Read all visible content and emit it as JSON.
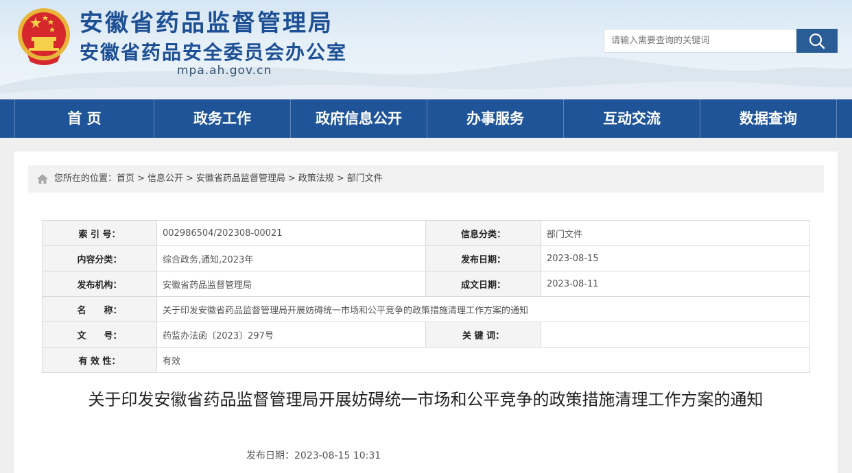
{
  "header": {
    "org_name": "安徽省药品监督管理局",
    "org_sub": "安徽省药品安全委员会办公室",
    "domain": "mpa.ah.gov.cn",
    "search_placeholder": "请输入需要查询的关键词",
    "emblem_icon": "national-emblem-icon",
    "search_icon": "search-icon"
  },
  "nav": {
    "items": [
      {
        "label": "首 页"
      },
      {
        "label": "政务工作"
      },
      {
        "label": "政府信息公开"
      },
      {
        "label": "办事服务"
      },
      {
        "label": "互动交流"
      },
      {
        "label": "数据查询"
      }
    ]
  },
  "breadcrumb": {
    "prefix": "您所在的位置：",
    "items": [
      "首页",
      "信息公开",
      "安徽省药品监督管理局",
      "政策法规",
      "部门文件"
    ],
    "separator": ">",
    "icon": "home-icon"
  },
  "meta": {
    "index_label": "索 引 号：",
    "index_value": "002986504/202308-00021",
    "category_label": "信息分类：",
    "category_value": "部门文件",
    "content_label": "内容分类：",
    "content_value": "综合政务,通知,2023年",
    "pubdate_label": "发布日期：",
    "pubdate_value": "2023-08-15",
    "org_label": "发布机构：",
    "org_value": "安徽省药品监督管理局",
    "made_label": "成文日期：",
    "made_value": "2023-08-11",
    "name_label": "名　　称：",
    "name_value": "关于印发安徽省药品监督管理局开展妨碍统一市场和公平竞争的政策措施清理工作方案的通知",
    "docno_label": "文　　号：",
    "docno_value": "药监办法函〔2023〕297号",
    "keyword_label": "关 键 词：",
    "keyword_value": "",
    "validity_label": "有 效 性：",
    "validity_value": "有效"
  },
  "article": {
    "title": "关于印发安徽省药品监督管理局开展妨碍统一市场和公平竞争的政策措施清理工作方案的通知",
    "date_line": "发布日期：2023-08-15 10:31"
  },
  "colors": {
    "brand_blue": "#1d4f95",
    "nav_bg": "#1f5498",
    "search_btn": "#2a5d96"
  }
}
